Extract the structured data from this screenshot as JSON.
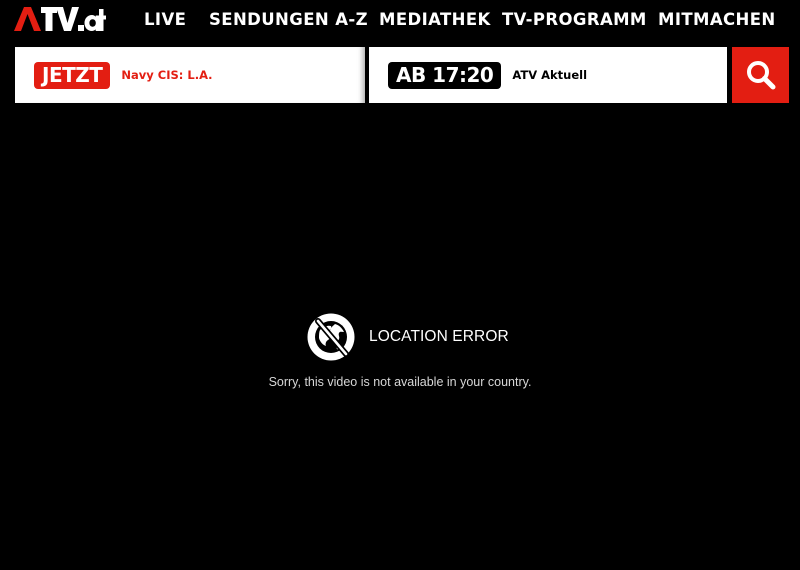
{
  "header": {
    "logo_text": "ATV.at",
    "nav": [
      {
        "label": "LIVE"
      },
      {
        "label": "SENDUNGEN A-Z"
      },
      {
        "label": "MEDIATHEK"
      },
      {
        "label": "TV-PROGRAMM"
      },
      {
        "label": "MITMACHEN"
      }
    ]
  },
  "program": {
    "now": {
      "badge": "JETZT",
      "title": "Navy CIS: L.A."
    },
    "next": {
      "badge": "AB 17:20",
      "title": "ATV Aktuell"
    }
  },
  "search": {
    "icon": "search-icon"
  },
  "player_error": {
    "icon": "location-off-icon",
    "title": "LOCATION ERROR",
    "message": "Sorry, this video is not available in your country."
  },
  "colors": {
    "brand_red": "#e31e12",
    "background": "#000000",
    "text_light": "#ffffff"
  }
}
